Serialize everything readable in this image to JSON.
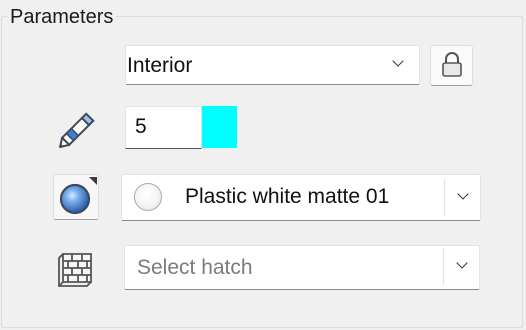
{
  "panel": {
    "title": "Parameters"
  },
  "interior_select": {
    "value": "Interior"
  },
  "line_weight": {
    "value": "5"
  },
  "material": {
    "value": "Plastic white matte 01"
  },
  "hatch": {
    "placeholder": "Select hatch"
  },
  "icons": {
    "lock": "lock-icon",
    "pen": "pen-icon",
    "material": "material-sphere-icon",
    "hatch": "hatch-brick-icon"
  },
  "colors": {
    "line_color": "#00ffff",
    "background": "#f0f0f0",
    "pen_blue": "#3b7fd6"
  }
}
